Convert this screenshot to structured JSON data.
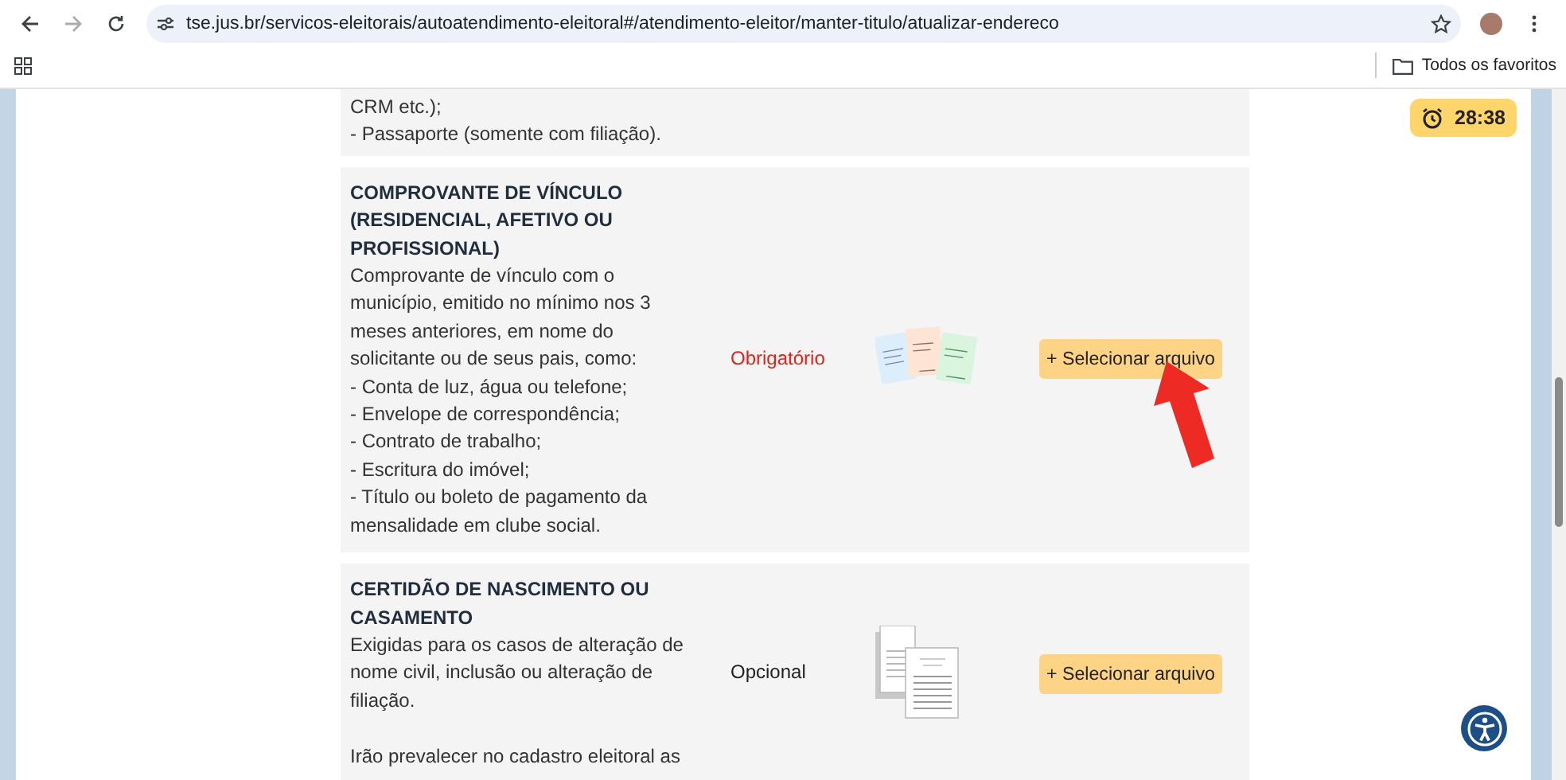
{
  "browser": {
    "url": "tse.jus.br/servicos-eleitorais/autoatendimento-eleitoral#/atendimento-eleitor/manter-titulo/atualizar-endereco",
    "forward_enabled": false,
    "bookmarks_label": "Todos os favoritos"
  },
  "timer": "28:38",
  "documents": [
    {
      "paragraphs": [
        "CRM etc.);",
        "- Passaporte (somente com filiação)."
      ]
    },
    {
      "title": "COMPROVANTE DE VÍNCULO (RESIDENCIAL, AFETIVO OU PROFISSIONAL)",
      "paragraphs": [
        "Comprovante de vínculo com o município, emitido no mínimo nos 3 meses anteriores, em nome do solicitante ou de seus pais, como:",
        "- Conta de luz, água ou telefone;",
        "- Envelope de correspondência;",
        "- Contrato de trabalho;",
        "- Escritura do imóvel;",
        "- Título ou boleto de pagamento da mensalidade em clube social."
      ],
      "requirement": {
        "text": "Obrigatório",
        "kind": "required"
      },
      "illustration": {
        "kind": "bills"
      },
      "button": "+ Selecionar arquivo",
      "arrow": true
    },
    {
      "title": "CERTIDÃO DE NASCIMENTO OU CASAMENTO",
      "paragraphs": [
        "Exigidas para os casos de alteração de nome civil, inclusão ou alteração de filiação.",
        "Irão prevalecer no cadastro eleitoral as"
      ],
      "requirement": {
        "text": "Opcional",
        "kind": "optional"
      },
      "illustration": {
        "kind": "certificates"
      },
      "button": "+ Selecionar arquivo"
    }
  ]
}
